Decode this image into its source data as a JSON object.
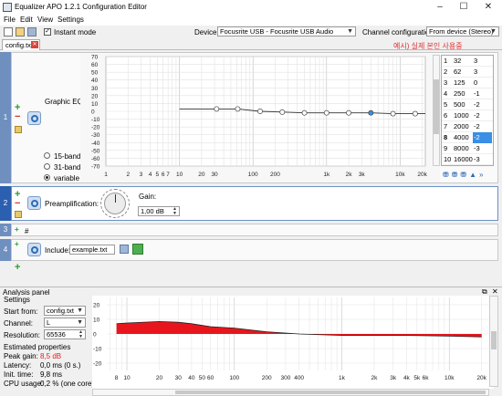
{
  "window": {
    "title": "Equalizer APO 1.2.1 Configuration Editor",
    "minimize": "–",
    "maximize": "☐",
    "close": "✕"
  },
  "menu": [
    "File",
    "Edit",
    "View",
    "Settings"
  ],
  "toolbar": {
    "instant_mode_label": "Instant mode",
    "device_label": "Device:",
    "device_value": "Focusrite USB - Focusrite USB Audio",
    "channel_label": "Channel configuration:",
    "channel_value": "From device (Stereo)"
  },
  "tab": {
    "name": "config.txt",
    "note": "예시) 실제 본인 사용중"
  },
  "filters": [
    {
      "number": "1",
      "type_label": "Graphic EQ:",
      "band_options": [
        "15-band",
        "31-band",
        "variable"
      ],
      "selected_band": "variable"
    },
    {
      "number": "2",
      "type_label": "Preamplification:",
      "gain_label": "Gain:",
      "gain_value": "1,00 dB"
    },
    {
      "number": "3",
      "text": "#"
    },
    {
      "number": "4",
      "include_label": "Include:",
      "include_value": "example.txt"
    }
  ],
  "eq_table": [
    {
      "index": "1",
      "freq": "32",
      "gain": "3"
    },
    {
      "index": "2",
      "freq": "62",
      "gain": "3"
    },
    {
      "index": "3",
      "freq": "125",
      "gain": "0"
    },
    {
      "index": "4",
      "freq": "250",
      "gain": "-1"
    },
    {
      "index": "5",
      "freq": "500",
      "gain": "-2"
    },
    {
      "index": "6",
      "freq": "1000",
      "gain": "-2"
    },
    {
      "index": "7",
      "freq": "2000",
      "gain": "-2"
    },
    {
      "index": "8",
      "freq": "4000",
      "gain": "-2"
    },
    {
      "index": "9",
      "freq": "8000",
      "gain": "-3"
    },
    {
      "index": "10",
      "freq": "16000",
      "gain": "-3"
    }
  ],
  "eq_selected_row": 7,
  "eq_graph": {
    "y_ticks": [
      "70",
      "60",
      "50",
      "40",
      "30",
      "20",
      "10",
      "0",
      "-10",
      "-20",
      "-30",
      "-40",
      "-50",
      "-60",
      "-70"
    ],
    "x_ticks": [
      "1",
      "2",
      "3",
      "4",
      "5",
      "6",
      "7",
      "10",
      "20",
      "30",
      "100",
      "200",
      "1k",
      "2k",
      "3k",
      "10k",
      "20k"
    ],
    "curve_color": "#333333",
    "selected_point_color": "#3a8ee6"
  },
  "analysis": {
    "panel_title": "Analysis panel",
    "settings_label": "Settings",
    "start_from_label": "Start from:",
    "start_from_value": "config.txt",
    "channel_label": "Channel:",
    "channel_value": "L",
    "resolution_label": "Resolution:",
    "resolution_value": "65536",
    "estimated_label": "Estimated properties",
    "peak_gain_label": "Peak gain:",
    "peak_gain_value": "8,5 dB",
    "latency_label": "Latency:",
    "latency_value": "0,0 ms (0 s.)",
    "init_time_label": "Init. time:",
    "init_time_value": "9,8 ms",
    "cpu_label": "CPU usage:",
    "cpu_value": "0,2 % (one core)",
    "y_ticks": [
      "20",
      "10",
      "0",
      "-10",
      "-20"
    ],
    "x_ticks": [
      "8",
      "10",
      "20",
      "30",
      "40",
      "50",
      "60",
      "100",
      "200",
      "300",
      "400",
      "1k",
      "2k",
      "3k",
      "4k",
      "5k",
      "6k",
      "10k",
      "20k"
    ],
    "fill_color": "#e8161c"
  },
  "chart_data": [
    {
      "type": "line",
      "title": "",
      "xlabel": "",
      "ylabel": "",
      "x_scale": "log",
      "ylim": [
        -70,
        70
      ],
      "x": [
        32,
        62,
        125,
        250,
        500,
        1000,
        2000,
        4000,
        8000,
        16000
      ],
      "y": [
        3,
        3,
        0,
        -1,
        -2,
        -2,
        -2,
        -2,
        -3,
        -3
      ],
      "grid": true
    },
    {
      "type": "area",
      "title": "",
      "x_scale": "log",
      "ylim": [
        -25,
        25
      ],
      "x": [
        8,
        10,
        20,
        30,
        40,
        60,
        100,
        200,
        400,
        1000,
        2000,
        4000,
        10000,
        20000
      ],
      "y": [
        7,
        7.5,
        8.5,
        8,
        7,
        5,
        4,
        1.5,
        0,
        -1,
        -1,
        -1,
        -1.5,
        -2
      ],
      "grid": true
    }
  ]
}
